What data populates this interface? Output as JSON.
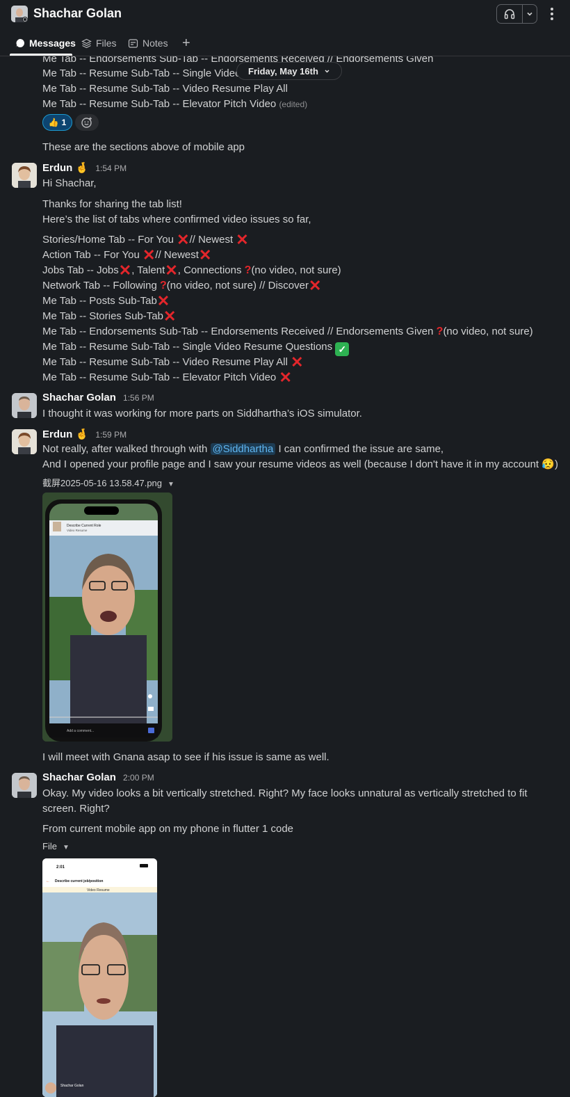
{
  "header": {
    "title": "Shachar Golan"
  },
  "tabs": [
    {
      "label": "Messages"
    },
    {
      "label": "Files"
    },
    {
      "label": "Notes"
    }
  ],
  "date_divider": "Friday, May 16th",
  "top_lines": [
    "Me Tab -- Endorsements Sub-Tab -- Endorsements Received // Endorsements Given",
    "Me Tab -- Resume Sub-Tab -- Single Video",
    "Me Tab -- Resume Sub-Tab -- Video Resume Play All",
    "Me Tab -- Resume Sub-Tab -- Elevator Pitch Video"
  ],
  "edited_label": "(edited)",
  "reaction": {
    "count": "1"
  },
  "sections_line": "These are the sections above of mobile app",
  "messages": {
    "erdun1": {
      "sender": "Erdun",
      "time": "1:54 PM",
      "greeting": "Hi Shachar,",
      "intro1": "Thanks for sharing the tab list!",
      "intro2": "Here’s the list of tabs where confirmed video issues so far,",
      "rows": {
        "r1a": "Stories/Home Tab -- For You",
        "r1b": "// Newest",
        "r2a": "Action Tab -- For You",
        "r2b": "// Newest",
        "r3a": "Jobs Tab -- Jobs",
        "r3b": ", Talent",
        "r3c": ", Connections",
        "r3d": "(no video, not sure)",
        "r4a": "Network Tab -- Following",
        "r4b": "(no video, not sure) // Discover",
        "r5": "Me Tab -- Posts Sub-Tab",
        "r6": "Me Tab -- Stories Sub-Tab",
        "r7a": "Me Tab -- Endorsements Sub-Tab -- Endorsements Received // Endorsements Given",
        "r7b": "(no video, not sure)",
        "r8": "Me Tab -- Resume Sub-Tab -- Single Video Resume Questions",
        "r9": "Me Tab -- Resume Sub-Tab -- Video Resume Play All",
        "r10": "Me Tab -- Resume Sub-Tab -- Elevator Pitch Video"
      }
    },
    "shachar1": {
      "sender": "Shachar Golan",
      "time": "1:56 PM",
      "text": "I thought it was working for more parts on Siddhartha’s iOS simulator."
    },
    "erdun2": {
      "sender": "Erdun",
      "time": "1:59 PM",
      "line1a": "Not really, after walked through with",
      "mention": "@Siddhartha",
      "line1b": "I can confirmed the issue are same,",
      "line2": "And I opened your profile page and I saw your resume videos as well (because I don't have it in my account",
      "file_name": "截屏2025-05-16 13.58.47.png",
      "shot_title": "Describe Current Role",
      "shot_subtitle": "Video Resume",
      "shot_comment": "Add a comment...",
      "followup": "I will meet with Gnana asap to see if his issue is same as well."
    },
    "shachar2": {
      "sender": "Shachar Golan",
      "time": "2:00 PM",
      "line1": "Okay. My video looks a bit vertically stretched. Right? My face looks unnatural as vertically stretched to fit",
      "line2": "screen. Right?",
      "line3": "From current mobile app on my phone in flutter 1 code",
      "file_label": "File",
      "shot_time": "2:01",
      "shot_title": "Describe current job/position",
      "shot_subtitle": "Video Resume",
      "shot_name": "Shachar Golan"
    }
  },
  "colors": {
    "background": "#1a1d21",
    "error_red": "#e3262b",
    "success_green": "#2eb152",
    "mention_blue": "#5fb5f0",
    "reaction_blue": "#1d9bd1"
  }
}
